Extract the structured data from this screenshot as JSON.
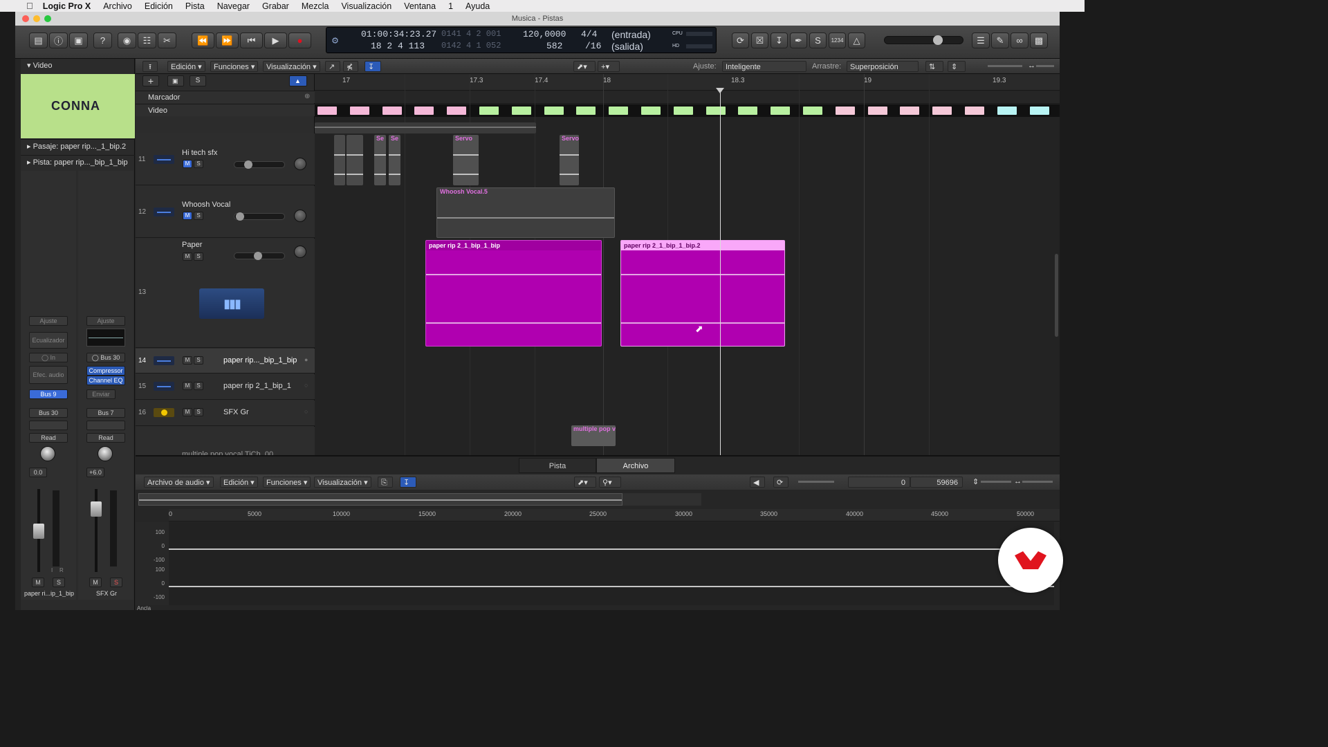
{
  "menubar": {
    "app": "Logic Pro X",
    "items": [
      "Archivo",
      "Edición",
      "Pista",
      "Navegar",
      "Grabar",
      "Mezcla",
      "Visualización",
      "Ventana",
      "1",
      "Ayuda"
    ]
  },
  "window": {
    "title": "Musica - Pistas"
  },
  "lcd": {
    "smpte": "01:00:34:23.27",
    "smpte_dim": "0141  4  2  001",
    "bars": "18  2  4  113",
    "bars_dim": "0142  4  1  052",
    "tempo": "120,0000",
    "tempo2": "582",
    "sig": "4/4",
    "div": "/16",
    "in": "(entrada)",
    "out": "(salida)",
    "cpu": "CPU",
    "hd": "HD"
  },
  "controlbar": {
    "count_label": "1234"
  },
  "inspector": {
    "video_label": "Video",
    "thumb_text": "CONNA",
    "pasaje": "Pasaje:  paper rip..._1_bip.2",
    "pista": "Pista:  paper rip..._bip_1_bip",
    "strip1": {
      "ajuste": "Ajuste",
      "eq": "Ecualizador",
      "in": "In",
      "efec": "Efec. audio",
      "bus_send": "Bus 9",
      "bus_out": "Bus 30",
      "auto": "Read",
      "value": "0.0",
      "name": "paper ri...ip_1_bip",
      "meter_i": "I",
      "meter_r": "R",
      "m": "M",
      "s": "S"
    },
    "strip2": {
      "ajuste": "Ajuste",
      "bus_in": "Bus 30",
      "plugin1": "Compressor",
      "plugin2": "Channel EQ",
      "enviar": "Enviar",
      "bus_out": "Bus 7",
      "auto": "Read",
      "value": "+6.0",
      "name": "SFX Gr",
      "m": "M",
      "s": "S"
    }
  },
  "tracksbar": {
    "edicion": "Edición",
    "funciones": "Funciones",
    "visualizacion": "Visualización",
    "ajuste_label": "Ajuste:",
    "ajuste_value": "Inteligente",
    "arrastre_label": "Arrastre:",
    "arrastre_value": "Superposición"
  },
  "ruler": {
    "marks": [
      "17",
      "17.3",
      "17.4",
      "18",
      "18.3",
      "19",
      "19.3"
    ]
  },
  "global_tracks": {
    "marcador": "Marcador",
    "video": "Video"
  },
  "header_btns": {
    "add": "+",
    "s": "S"
  },
  "tracks": [
    {
      "num": "11",
      "name": "Hi tech sfx"
    },
    {
      "num": "12",
      "name": "Whoosh Vocal"
    },
    {
      "num": "13",
      "name": "Paper"
    },
    {
      "num": "14",
      "name": "paper rip..._bip_1_bip"
    },
    {
      "num": "15",
      "name": "paper rip 2_1_bip_1"
    },
    {
      "num": "16",
      "name": "SFX Gr"
    },
    {
      "num": "",
      "name": "multiple pop vocal TiCh_00"
    }
  ],
  "regions": {
    "se1": "Se",
    "se2": "Se",
    "servo1": "Servo",
    "servo2": "Servo",
    "whoosh": "Whoosh Vocal.5",
    "paper1": "paper rip 2_1_bip_1_bip",
    "paper2": "paper rip 2_1_bip_1_bip.2",
    "pop": "multiple pop v"
  },
  "editor": {
    "tab_pista": "Pista",
    "tab_archivo": "Archivo",
    "menu1": "Archivo de audio",
    "menu2": "Edición",
    "menu3": "Funciones",
    "menu4": "Visualización",
    "field_start": "0",
    "field_end": "59696",
    "ruler": [
      "0",
      "5000",
      "10000",
      "15000",
      "20000",
      "25000",
      "30000",
      "35000",
      "40000",
      "45000",
      "50000"
    ],
    "scale": [
      "100",
      "0",
      "-100",
      "100",
      "0",
      "-100"
    ],
    "ancla": "Ancla"
  },
  "colors": {
    "accent": "#3a6bd8",
    "region_magenta": "#b000b0",
    "region_gray": "#5a5a5a"
  }
}
